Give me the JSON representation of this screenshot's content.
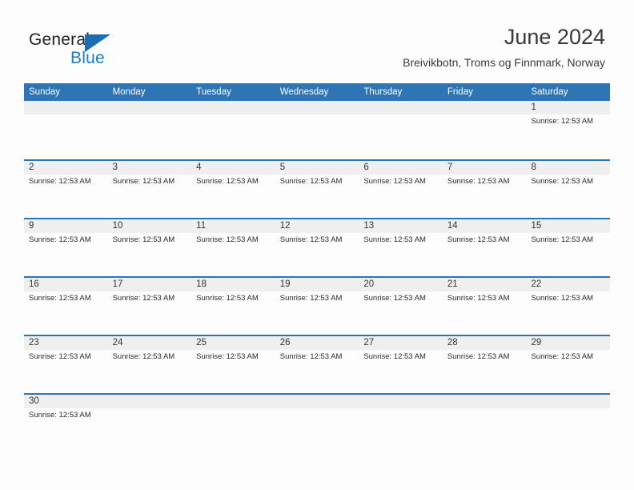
{
  "brand": {
    "name_part1": "General",
    "name_part2": "Blue",
    "triangle_color": "#1B6CB0",
    "blue_text_color": "#1B7BC4"
  },
  "header": {
    "title": "June 2024",
    "subtitle": "Breivikbotn, Troms og Finnmark, Norway"
  },
  "theme": {
    "header_blue": "#2E75B6",
    "day_band_gray": "#EFEFEF",
    "page_background": "#FDFDFD",
    "text_color": "#2A2A2A"
  },
  "calendar": {
    "weekdays": [
      "Sunday",
      "Monday",
      "Tuesday",
      "Wednesday",
      "Thursday",
      "Friday",
      "Saturday"
    ],
    "weeks": [
      [
        {
          "day": "",
          "event": ""
        },
        {
          "day": "",
          "event": ""
        },
        {
          "day": "",
          "event": ""
        },
        {
          "day": "",
          "event": ""
        },
        {
          "day": "",
          "event": ""
        },
        {
          "day": "",
          "event": ""
        },
        {
          "day": "1",
          "event": "Sunrise: 12:53 AM"
        }
      ],
      [
        {
          "day": "2",
          "event": "Sunrise: 12:53 AM"
        },
        {
          "day": "3",
          "event": "Sunrise: 12:53 AM"
        },
        {
          "day": "4",
          "event": "Sunrise: 12:53 AM"
        },
        {
          "day": "5",
          "event": "Sunrise: 12:53 AM"
        },
        {
          "day": "6",
          "event": "Sunrise: 12:53 AM"
        },
        {
          "day": "7",
          "event": "Sunrise: 12:53 AM"
        },
        {
          "day": "8",
          "event": "Sunrise: 12:53 AM"
        }
      ],
      [
        {
          "day": "9",
          "event": "Sunrise: 12:53 AM"
        },
        {
          "day": "10",
          "event": "Sunrise: 12:53 AM"
        },
        {
          "day": "11",
          "event": "Sunrise: 12:53 AM"
        },
        {
          "day": "12",
          "event": "Sunrise: 12:53 AM"
        },
        {
          "day": "13",
          "event": "Sunrise: 12:53 AM"
        },
        {
          "day": "14",
          "event": "Sunrise: 12:53 AM"
        },
        {
          "day": "15",
          "event": "Sunrise: 12:53 AM"
        }
      ],
      [
        {
          "day": "16",
          "event": "Sunrise: 12:53 AM"
        },
        {
          "day": "17",
          "event": "Sunrise: 12:53 AM"
        },
        {
          "day": "18",
          "event": "Sunrise: 12:53 AM"
        },
        {
          "day": "19",
          "event": "Sunrise: 12:53 AM"
        },
        {
          "day": "20",
          "event": "Sunrise: 12:53 AM"
        },
        {
          "day": "21",
          "event": "Sunrise: 12:53 AM"
        },
        {
          "day": "22",
          "event": "Sunrise: 12:53 AM"
        }
      ],
      [
        {
          "day": "23",
          "event": "Sunrise: 12:53 AM"
        },
        {
          "day": "24",
          "event": "Sunrise: 12:53 AM"
        },
        {
          "day": "25",
          "event": "Sunrise: 12:53 AM"
        },
        {
          "day": "26",
          "event": "Sunrise: 12:53 AM"
        },
        {
          "day": "27",
          "event": "Sunrise: 12:53 AM"
        },
        {
          "day": "28",
          "event": "Sunrise: 12:53 AM"
        },
        {
          "day": "29",
          "event": "Sunrise: 12:53 AM"
        }
      ],
      [
        {
          "day": "30",
          "event": "Sunrise: 12:53 AM"
        },
        {
          "day": "",
          "event": ""
        },
        {
          "day": "",
          "event": ""
        },
        {
          "day": "",
          "event": ""
        },
        {
          "day": "",
          "event": ""
        },
        {
          "day": "",
          "event": ""
        },
        {
          "day": "",
          "event": ""
        }
      ]
    ]
  }
}
